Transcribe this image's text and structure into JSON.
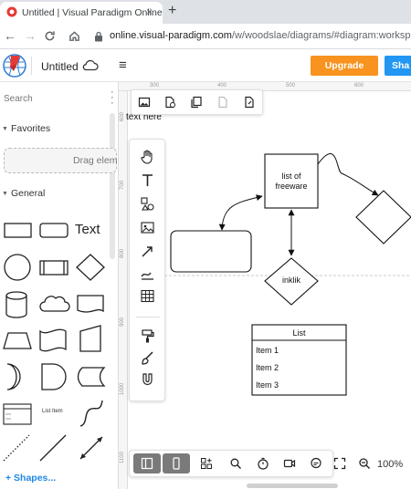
{
  "browser": {
    "tab_title": "Untitled | Visual Paradigm Online",
    "tab_close": "×",
    "new_tab": "+",
    "url_host": "online.visual-paradigm.com",
    "url_path": "/w/woodslae/diagrams/#diagram:workspace"
  },
  "app": {
    "doc_title": "Untitled",
    "upgrade_label": "Upgrade",
    "share_label": "Sha",
    "menu_icon": "≡"
  },
  "left_panel": {
    "search_placeholder": "Search",
    "favorites_label": "Favorites",
    "drop_hint": "Drag elem",
    "general_label": "General",
    "text_shape_label": "Text",
    "list_item_shape_label": "List Item",
    "shapes_link": "+ Shapes..."
  },
  "canvas": {
    "ruler_top": [
      "300",
      "400",
      "500",
      "600"
    ],
    "ruler_left": [
      "700",
      "800",
      "900",
      "1000",
      "1100"
    ],
    "ruler_first": "600",
    "label_overlay": "text here",
    "node_freeware": [
      "list of",
      "freeware"
    ],
    "node_inklik": "inklik",
    "list_header": "List",
    "list_items": [
      "Item 1",
      "Item 2",
      "Item 3"
    ]
  },
  "zoom": {
    "level": "100%"
  },
  "colors": {
    "upgrade": "#f7931e",
    "share": "#2196f3",
    "link": "#1e88e5"
  }
}
